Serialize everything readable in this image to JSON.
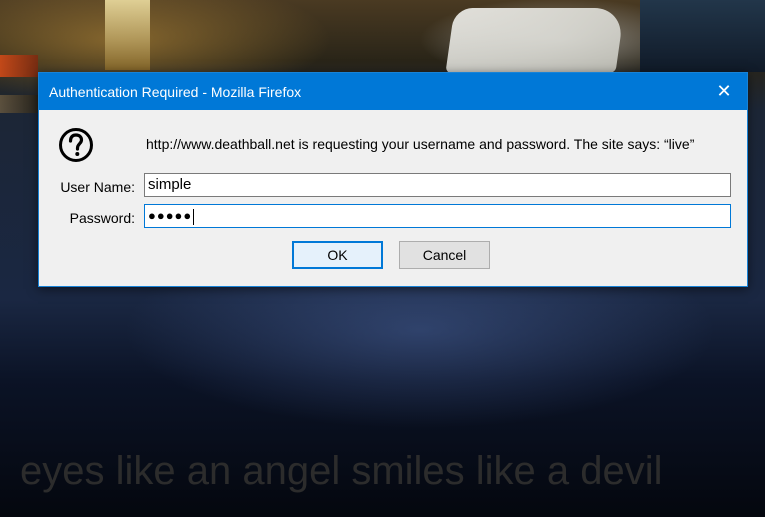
{
  "background": {
    "caption": "eyes like an angel smiles like a devil"
  },
  "dialog": {
    "title": "Authentication Required - Mozilla Firefox",
    "close_label": "✕",
    "icon": "question-icon",
    "message": "http://www.deathball.net is requesting your username and password. The site says: “live”",
    "username_label": "User Name:",
    "username_value": "simple",
    "password_label": "Password:",
    "password_value": "●●●●●",
    "ok_label": "OK",
    "cancel_label": "Cancel"
  },
  "colors": {
    "titlebar": "#0078d7",
    "dialog_bg": "#f0f0f0",
    "focus_border": "#0078d7"
  }
}
